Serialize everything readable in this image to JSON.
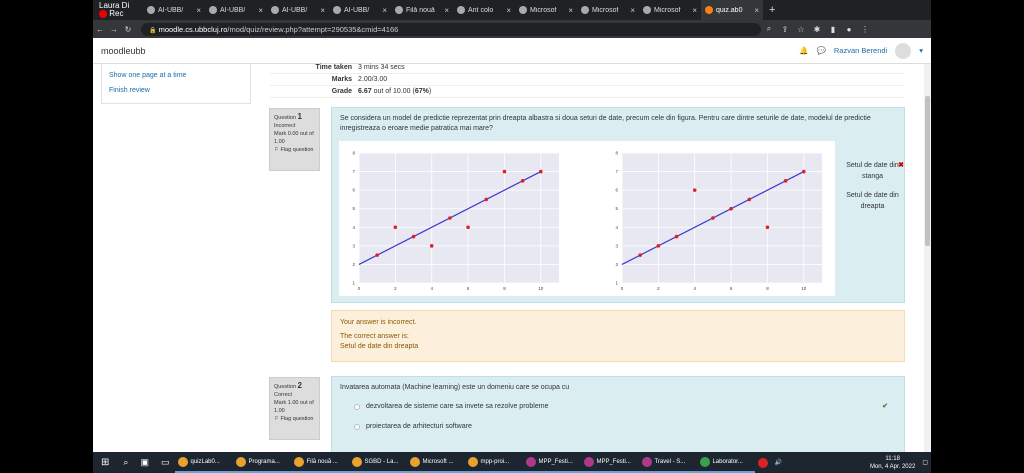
{
  "recorder": {
    "user": "Laura Di",
    "label": "Rec"
  },
  "tabs": [
    {
      "label": "AI-UBB/",
      "icon": "github-icon"
    },
    {
      "label": "AI-UBB/",
      "icon": "github-icon"
    },
    {
      "label": "AI-UBB/",
      "icon": "github-icon"
    },
    {
      "label": "AI-UBB/",
      "icon": "github-icon"
    },
    {
      "label": "Filă nouă",
      "icon": "new-tab-icon"
    },
    {
      "label": "Ant colo",
      "icon": "web-icon"
    },
    {
      "label": "Microsof",
      "icon": "web-icon"
    },
    {
      "label": "Microsof",
      "icon": "web-icon"
    },
    {
      "label": "Microsof",
      "icon": "web-icon"
    },
    {
      "label": "quiz.ab0",
      "icon": "moodle-icon",
      "active": true
    }
  ],
  "address": {
    "domain": "moodle.cs.ubbcluj.ro",
    "path": "/mod/quiz/review.php?attempt=290535&cmid=4166"
  },
  "header": {
    "brand": "moodleubb",
    "user": "Razvan Berendi"
  },
  "sidebar": {
    "links": [
      "Show one page at a time",
      "Finish review"
    ]
  },
  "summary": [
    {
      "key": "Time taken",
      "value": "3 mins 34 secs"
    },
    {
      "key": "Marks",
      "value": "2.00/3.00"
    },
    {
      "key": "Grade",
      "value_bold": "6.67",
      "value_rest": " out of 10.00 (",
      "percent": "67%",
      "tail": ")"
    }
  ],
  "q1": {
    "label": "Question",
    "number": "1",
    "state": "Incorrect",
    "mark": "Mark 0.00 out of 1.00",
    "flag": "Flag question",
    "text": "Se considera un model de predictie reprezentat prin dreapta albastra si doua seturi de date, precum cele din figura. Pentru care dintre seturile de date, modelul de predictie inregistreaza o eroare medie patratica mai mare?",
    "answers": [
      "Setul de date din stanga",
      "Setul de date din dreapta"
    ],
    "wrong_mark": "✖",
    "feedback": {
      "line1": "Your answer is incorrect.",
      "line2": "The correct answer is:",
      "line3": "Setul de date din dreapta"
    }
  },
  "chart_data": [
    {
      "type": "scatter",
      "xlim": [
        0,
        11
      ],
      "ylim": [
        1,
        8
      ],
      "xticks": [
        0,
        2,
        4,
        6,
        8,
        10
      ],
      "yticks": [
        1,
        2,
        3,
        4,
        5,
        6,
        7,
        8
      ],
      "points": [
        [
          1,
          2.5
        ],
        [
          2,
          4
        ],
        [
          3,
          3.5
        ],
        [
          4,
          3
        ],
        [
          5,
          4.5
        ],
        [
          6,
          4
        ],
        [
          7,
          5.5
        ],
        [
          8,
          7
        ],
        [
          9,
          6.5
        ],
        [
          10,
          7
        ]
      ],
      "line": [
        [
          0,
          2
        ],
        [
          10,
          7
        ]
      ],
      "point_color": "#e02020",
      "line_color": "#3a3ad0"
    },
    {
      "type": "scatter",
      "xlim": [
        0,
        11
      ],
      "ylim": [
        1,
        8
      ],
      "xticks": [
        0,
        2,
        4,
        6,
        8,
        10
      ],
      "yticks": [
        1,
        2,
        3,
        4,
        5,
        6,
        7,
        8
      ],
      "points": [
        [
          1,
          2.5
        ],
        [
          2,
          3
        ],
        [
          3,
          3.5
        ],
        [
          4,
          6
        ],
        [
          5,
          4.5
        ],
        [
          6,
          5
        ],
        [
          7,
          5.5
        ],
        [
          8,
          4
        ],
        [
          9,
          6.5
        ],
        [
          10,
          7
        ]
      ],
      "line": [
        [
          0,
          2
        ],
        [
          10,
          7
        ]
      ],
      "point_color": "#e02020",
      "line_color": "#3a3ad0"
    }
  ],
  "q2": {
    "label": "Question",
    "number": "2",
    "state": "Correct",
    "mark": "Mark 1.00 out of 1.00",
    "flag": "Flag question",
    "text": "Invatarea automata (Machine learning) este un domeniu care se ocupa cu",
    "options": [
      "dezvoltarea de sisteme care sa invete sa rezolve probleme",
      "proiectarea de arhitecturi software"
    ],
    "correct_mark": "✔"
  },
  "taskbar": {
    "apps": [
      "quizLab0...",
      "Programa...",
      "Filă nouă ...",
      "SGBD - La...",
      "Microsoft ...",
      "mpp-proi...",
      "MPP_Festi...",
      "MPP_Festi...",
      "Travel - S...",
      "Laborator..."
    ],
    "time": "11:18",
    "date": "Mon, 4 Apr. 2022"
  }
}
